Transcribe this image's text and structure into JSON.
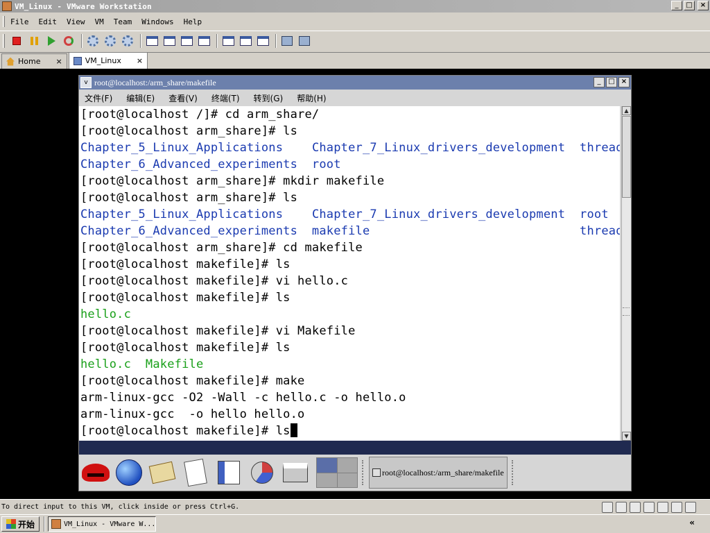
{
  "app": {
    "title": "VM_Linux - VMware Workstation"
  },
  "window_controls": {
    "minimize": "_",
    "maximize": "□",
    "close": "×"
  },
  "menubar": {
    "items": [
      "File",
      "Edit",
      "View",
      "VM",
      "Team",
      "Windows",
      "Help"
    ]
  },
  "tabs": [
    {
      "label": "Home",
      "close": "×"
    },
    {
      "label": "VM_Linux",
      "close": "×"
    }
  ],
  "terminal": {
    "title": "root@localhost:/arm_share/makefile",
    "menu_arrow": "v",
    "controls": {
      "minimize": "_",
      "maximize": "□",
      "close": "×"
    },
    "menu": [
      "文件(F)",
      "编辑(E)",
      "查看(V)",
      "终端(T)",
      "转到(G)",
      "帮助(H)"
    ],
    "lines": [
      {
        "text": "[root@localhost /]# cd arm_share/"
      },
      {
        "text": "[root@localhost arm_share]# ls"
      },
      {
        "segments": [
          {
            "t": "Chapter_5_Linux_Applications",
            "c": "dir"
          },
          {
            "t": "    "
          },
          {
            "t": "Chapter_7_Linux_drivers_development",
            "c": "dir"
          },
          {
            "t": "  "
          },
          {
            "t": "thread",
            "c": "dir"
          }
        ]
      },
      {
        "segments": [
          {
            "t": "Chapter_6_Advanced_experiments",
            "c": "dir"
          },
          {
            "t": "  "
          },
          {
            "t": "root",
            "c": "dir"
          }
        ]
      },
      {
        "text": "[root@localhost arm_share]# mkdir makefile"
      },
      {
        "text": "[root@localhost arm_share]# ls"
      },
      {
        "segments": [
          {
            "t": "Chapter_5_Linux_Applications",
            "c": "dir"
          },
          {
            "t": "    "
          },
          {
            "t": "Chapter_7_Linux_drivers_development",
            "c": "dir"
          },
          {
            "t": "  "
          },
          {
            "t": "root",
            "c": "dir"
          }
        ]
      },
      {
        "segments": [
          {
            "t": "Chapter_6_Advanced_experiments",
            "c": "dir"
          },
          {
            "t": "  "
          },
          {
            "t": "makefile",
            "c": "dir"
          },
          {
            "t": "                             "
          },
          {
            "t": "thread",
            "c": "dir"
          }
        ]
      },
      {
        "text": "[root@localhost arm_share]# cd makefile"
      },
      {
        "text": "[root@localhost makefile]# ls"
      },
      {
        "text": "[root@localhost makefile]# vi hello.c"
      },
      {
        "text": "[root@localhost makefile]# ls"
      },
      {
        "segments": [
          {
            "t": "hello.c",
            "c": "file"
          }
        ]
      },
      {
        "text": "[root@localhost makefile]# vi Makefile"
      },
      {
        "text": "[root@localhost makefile]# ls"
      },
      {
        "segments": [
          {
            "t": "hello.c",
            "c": "file"
          },
          {
            "t": "  "
          },
          {
            "t": "Makefile",
            "c": "file"
          }
        ]
      },
      {
        "text": "[root@localhost makefile]# make"
      },
      {
        "text": "arm-linux-gcc -O2 -Wall -c hello.c -o hello.o"
      },
      {
        "text": "arm-linux-gcc  -o hello hello.o"
      },
      {
        "text": "[root@localhost makefile]# ls",
        "cursor": true
      }
    ],
    "scrollbar": {
      "up": "▲",
      "down": "▼"
    }
  },
  "guest_panel": {
    "task_label": "root@localhost:/arm_share/makefile"
  },
  "status": {
    "text": "To direct input to this VM, click inside or press Ctrl+G."
  },
  "host_taskbar": {
    "start_label": "开始",
    "task_label": "VM_Linux - VMware W...",
    "tray_arrow": "«"
  },
  "colors": {
    "dir": "#1a3ab0",
    "file": "#1aa01a",
    "terminal_title_bg": "#6c80ac",
    "guest_panel_strip": "#202a50"
  }
}
